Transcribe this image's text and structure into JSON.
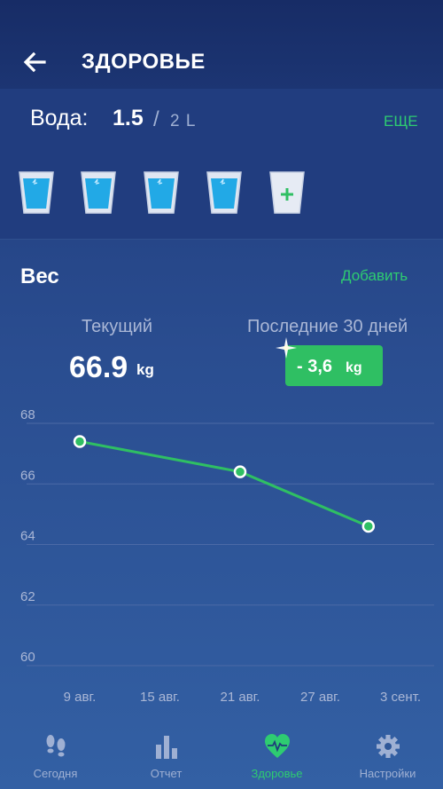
{
  "header": {
    "title": "ЗДОРОВЬЕ",
    "back_icon": "arrow-left-icon"
  },
  "water": {
    "label": "Вода:",
    "current": "1.5",
    "separator": "/",
    "goal": "2 L",
    "more_label": "ЕЩЕ",
    "glasses_filled": 4,
    "glasses_total": 5,
    "add_icon": "plus-icon"
  },
  "weight": {
    "title": "Вес",
    "add_label": "Добавить",
    "current_label": "Текущий",
    "current_value": "66.9",
    "current_unit": "kg",
    "last30_label": "Последние 30 дней",
    "delta_value": "- 3,6",
    "delta_unit": "kg"
  },
  "chart_data": {
    "type": "line",
    "x": [
      "9 авг.",
      "15 авг.",
      "21 авг.",
      "27 авг.",
      "3 сент."
    ],
    "yticks": [
      "68",
      "66",
      "64",
      "62",
      "60"
    ],
    "ylim": [
      60,
      68
    ],
    "points": [
      {
        "x_index": 0,
        "y": 67.4
      },
      {
        "x_index": 2,
        "y": 66.4
      },
      {
        "x_index": 3.6,
        "y": 64.6
      }
    ],
    "grid": true,
    "line_color": "#2fbf63"
  },
  "nav": {
    "items": [
      {
        "label": "Сегодня",
        "icon": "footsteps-icon",
        "active": false
      },
      {
        "label": "Отчет",
        "icon": "bar-chart-icon",
        "active": false
      },
      {
        "label": "Здоровье",
        "icon": "heart-pulse-icon",
        "active": true
      },
      {
        "label": "Настройки",
        "icon": "gear-icon",
        "active": false
      }
    ]
  },
  "colors": {
    "accent": "#2ecc71",
    "water": "#22a9e6",
    "background": "#2a4d90",
    "muted_text": "#aab7d6"
  }
}
